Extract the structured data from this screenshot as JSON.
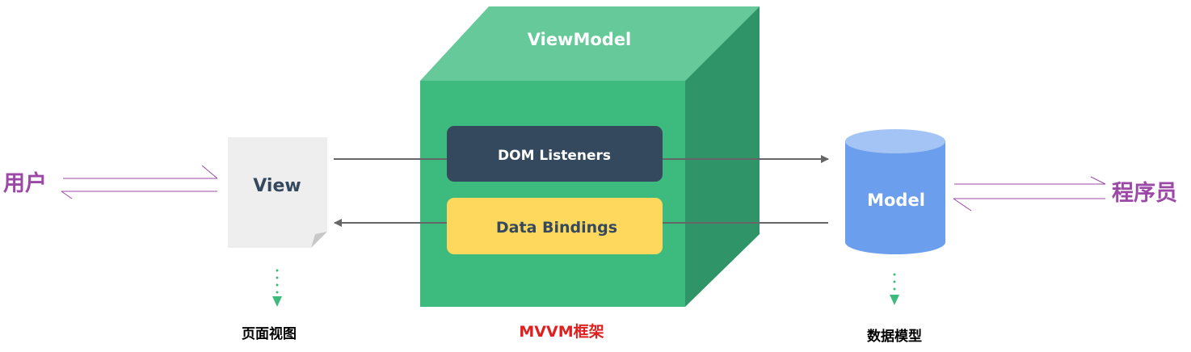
{
  "viewmodel": {
    "title": "ViewModel",
    "dom_listeners": "DOM Listeners",
    "data_bindings": "Data Bindings",
    "caption": "MVVM框架"
  },
  "view": {
    "title": "View",
    "caption": "页面视图"
  },
  "model": {
    "title": "Model",
    "caption": "数据模型"
  },
  "actors": {
    "user": "用户",
    "programmer": "程序员"
  },
  "colors": {
    "cube_front": "#3dba7e",
    "cube_top": "#65c99a",
    "cube_side": "#2f9468",
    "listeners": "#34495e",
    "bindings": "#fdd85d",
    "model": "#6c9eee",
    "actor": "#9b48a6",
    "caption_red": "#e02020"
  }
}
